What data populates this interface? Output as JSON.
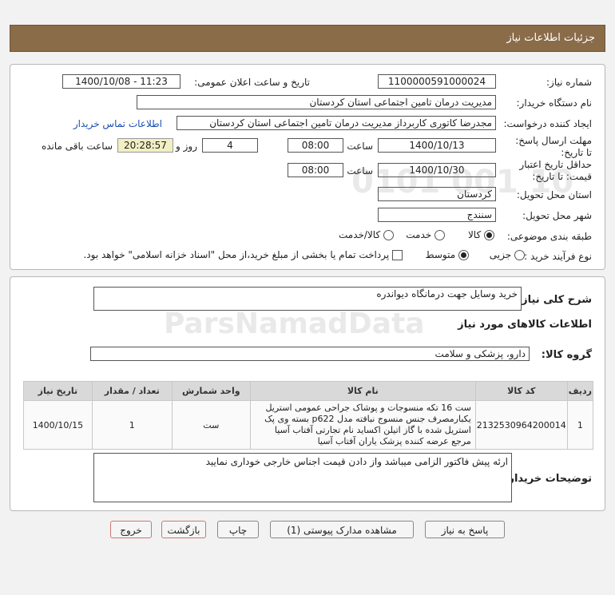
{
  "header": {
    "title": "جزئیات اطلاعات نیاز"
  },
  "fields": {
    "need_number_label": "شماره نیاز:",
    "need_number": "1100000591000024",
    "announce_label": "تاریخ و ساعت اعلان عمومی:",
    "announce_value": "1400/10/08 - 11:23",
    "buyer_org_label": "نام دستگاه خریدار:",
    "buyer_org": "مدیریت درمان تامین اجتماعی استان کردستان",
    "requester_label": "ایجاد کننده درخواست:",
    "requester": "مجدرضا کاتوری کاربرداز مدیریت درمان تامین اجتماعی استان کردستان",
    "contact_link": "اطلاعات تماس خریدار",
    "deadline_label": "مهلت ارسال پاسخ: تا تاریخ:",
    "deadline_date": "1400/10/13",
    "time_label": "ساعت",
    "deadline_time": "08:00",
    "days": "4",
    "days_label": "روز و",
    "remaining_time": "20:28:57",
    "remaining_label": "ساعت باقی مانده",
    "validity_label": "حداقل تاریخ اعتبار قیمت: تا تاریخ:",
    "validity_date": "1400/10/30",
    "validity_time": "08:00",
    "province_label": "استان محل تحویل:",
    "province": "کردستان",
    "city_label": "شهر محل تحویل:",
    "city": "سنندج",
    "category_label": "طبقه بندی موضوعی:",
    "category_goods": "کالا",
    "category_service": "خدمت",
    "category_both": "کالا/خدمت",
    "process_label": "نوع فرآیند خرید :",
    "process_partial": "جزیی",
    "process_medium": "متوسط",
    "payment_note": "پرداخت تمام یا بخشی از مبلغ خرید،از محل \"اسناد خزانه اسلامی\" خواهد بود."
  },
  "summary": {
    "label": "شرح کلی نیاز:",
    "value": "خرید وسایل جهت درمانگاه دیواندره",
    "goods_info_title": "اطلاعات کالاهای مورد نیاز",
    "goods_group_label": "گروه کالا:",
    "goods_group": "دارو، پزشکی و سلامت"
  },
  "table": {
    "headers": [
      "ردیف",
      "کد کالا",
      "نام کالا",
      "واحد شمارش",
      "تعداد / مقدار",
      "تاریخ نیاز"
    ],
    "rows": [
      {
        "row": "1",
        "code": "2132530964200014",
        "name": "ست 16 تکه منسوجات و پوشاک جراحی عمومی استریل یکبارمصرف جنس منسوج نبافته مدل p622 بسته وی پک استریل شده با گاز اتیلن اکساید نام تجارتی آفتاب آسیا مرجع عرضه کننده پزشک یاران آفتاب آسیا",
        "unit": "ست",
        "qty": "1",
        "date": "1400/10/15"
      }
    ]
  },
  "buyer_notes": {
    "label": "توضیحات خریدار:",
    "value": "ارئه پیش فاکتور الزامی میباشد واز دادن قیمت اجناس خارجی خوداری نمایید"
  },
  "buttons": {
    "reply": "پاسخ به نیاز",
    "attachments": "مشاهده مدارک پیوستی (1)",
    "print": "چاپ",
    "back": "بازگشت",
    "exit": "خروج"
  },
  "watermark": {
    "brand": "ParsNamadData",
    "code": "0101 001 10"
  }
}
